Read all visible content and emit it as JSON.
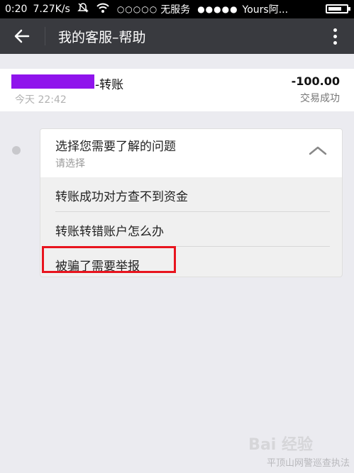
{
  "status_bar": {
    "time": "0:20",
    "speed": "7.27K/s",
    "signal_dots_1": "○○○○○",
    "carrier1": "无服务",
    "signal_dots_2": "●●●●●",
    "carrier2": "Yours阿..."
  },
  "title_bar": {
    "title": "我的客服–帮助"
  },
  "transaction": {
    "label": "-转账",
    "time": "今天 22:42",
    "amount": "-100.00",
    "status": "交易成功"
  },
  "question_panel": {
    "title": "选择您需要了解的问题",
    "subtitle": "请选择",
    "options": [
      {
        "label": "转账成功对方查不到资金"
      },
      {
        "label": "转账转错账户怎么办"
      },
      {
        "label": "被骗了需要举报"
      }
    ]
  },
  "watermark": {
    "logo": "Bai 经验",
    "text": "平顶山网警巡查执法"
  },
  "colors": {
    "title_bar_bg": "#393a3f",
    "highlight": "#e8141e",
    "name_mask": "#8f14ec"
  }
}
